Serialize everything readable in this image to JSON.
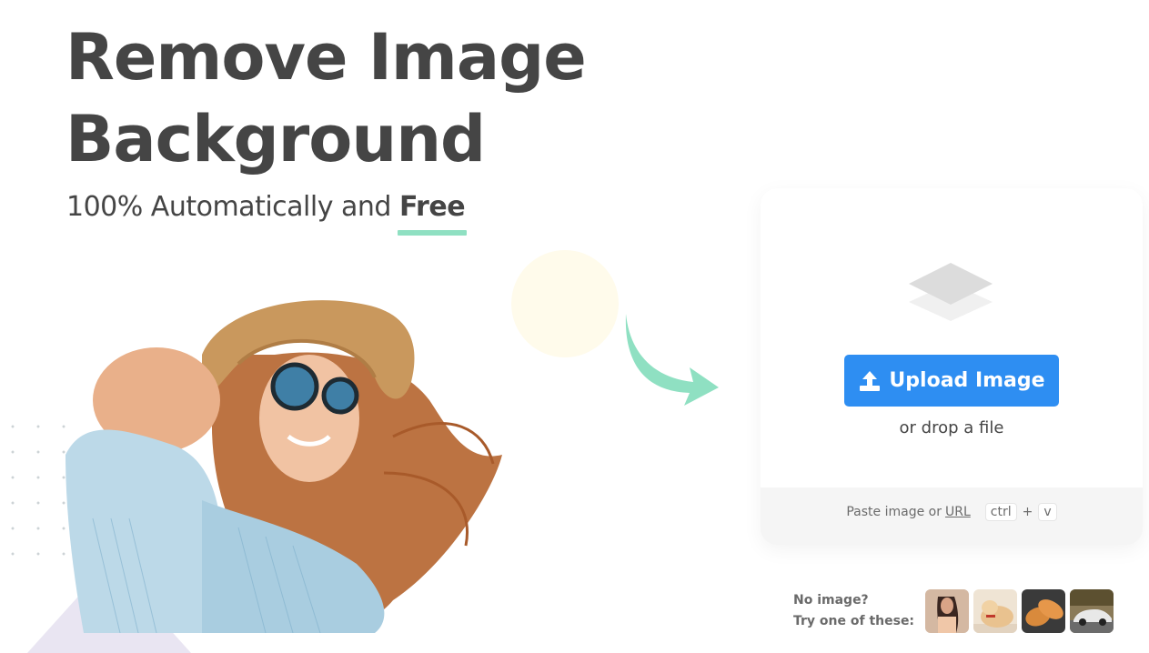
{
  "hero": {
    "title_line1": "Remove Image",
    "title_line2": "Background",
    "subtitle_prefix": "100% Automatically and ",
    "subtitle_emphasis": "Free"
  },
  "upload": {
    "button_label": "Upload Image",
    "drop_text": "or drop a file",
    "paste_prefix": "Paste image or",
    "url_link": "URL",
    "shortcut_key1": "ctrl",
    "shortcut_plus": "+",
    "shortcut_key2": "v"
  },
  "samples": {
    "line1": "No image?",
    "line2": "Try one of these:",
    "items": [
      {
        "subject": "woman"
      },
      {
        "subject": "dog"
      },
      {
        "subject": "bread"
      },
      {
        "subject": "car"
      }
    ]
  },
  "colors": {
    "accent_blue": "#2e8ef2",
    "accent_green": "#8fe0c2",
    "title_text": "#454545"
  }
}
